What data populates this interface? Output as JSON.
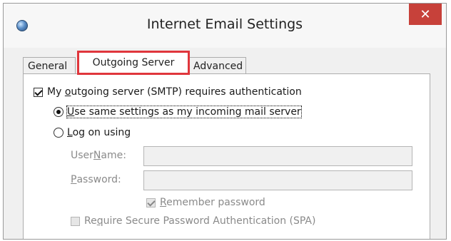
{
  "window": {
    "title": "Internet Email Settings",
    "close_label": "✕",
    "app_icon": "globe-mail-icon"
  },
  "tabs": [
    {
      "label": "General",
      "active": false
    },
    {
      "label": "Outgoing Server",
      "active": true
    },
    {
      "label": "Advanced",
      "active": false
    }
  ],
  "highlight_color": "#e0363c",
  "outgoing": {
    "requires_auth": {
      "pre": "My ",
      "accel": "o",
      "post": "utgoing server (SMTP) requires authentication",
      "checked": true
    },
    "same_settings": {
      "accel": "U",
      "post": "se same settings as my incoming mail server",
      "selected": true
    },
    "log_on": {
      "accel": "L",
      "post": "og on using",
      "selected": false
    },
    "user_name": {
      "pre": "User ",
      "accel": "N",
      "post": "ame:",
      "value": ""
    },
    "password": {
      "accel": "P",
      "post": "assword:",
      "value": ""
    },
    "remember": {
      "accel": "R",
      "post": "emember password",
      "checked": true
    },
    "spa": {
      "pre": "Re",
      "accel": "q",
      "post": "uire Secure Password Authentication (SPA)",
      "checked": false
    }
  }
}
